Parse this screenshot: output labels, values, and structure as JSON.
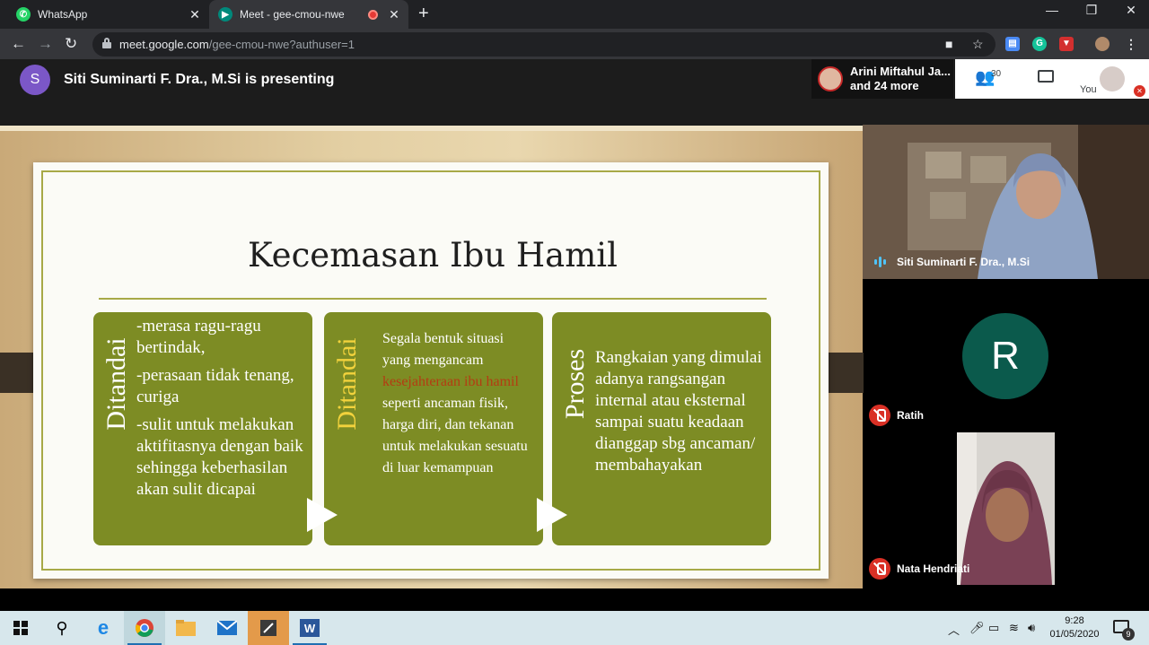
{
  "browser": {
    "tabs": [
      {
        "title": "WhatsApp",
        "icon": "whatsapp-icon",
        "active": false
      },
      {
        "title": "Meet - gee-cmou-nwe",
        "icon": "meet-icon",
        "active": true,
        "recording": true
      }
    ],
    "url_host": "meet.google.com",
    "url_path": "/gee-cmou-nwe?authuser=1"
  },
  "meet": {
    "presenter_initial": "S",
    "presenter_text": "Siti Suminarti F. Dra., M.Si is presenting",
    "attendees_line1": "Arini Miftahul Ja...",
    "attendees_line2": "and 24 more",
    "people_count": "30",
    "you_label": "You"
  },
  "slide": {
    "title": "Kecemasan Ibu Hamil",
    "cards": [
      {
        "vertical_label": "Ditandai",
        "label_color": "#ffffff",
        "lines": [
          "-merasa ragu-ragu bertindak,",
          "-perasaan tidak tenang, curiga",
          "-sulit untuk melakukan aktifitasnya dengan baik sehingga keberhasilan akan sulit dicapai"
        ]
      },
      {
        "vertical_label": "Ditandai",
        "label_color": "#f2d23c",
        "text_before": "Segala bentuk situasi yang mengancam ",
        "text_highlight": "kesejahteraan ibu hamil",
        "text_after": " seperti ancaman fisik, harga diri, dan tekanan untuk melakukan sesuatu di luar kemampuan"
      },
      {
        "vertical_label": "Proses",
        "label_color": "#ffffff",
        "text": "Rangkaian yang dimulai adanya rangsangan internal atau eksternal sampai suatu keadaan dianggap sbg ancaman/ membahayakan"
      }
    ]
  },
  "participants": [
    {
      "name": "Siti Suminarti F. Dra., M.Si",
      "speaking": true,
      "video": true
    },
    {
      "name": "Ratih",
      "initial": "R",
      "muted": true,
      "video": false
    },
    {
      "name": "Nata Hendriati",
      "muted": true,
      "video": true
    }
  ],
  "taskbar": {
    "time": "9:28",
    "date": "01/05/2020",
    "notification_count": "9"
  },
  "colors": {
    "slide_card": "#7d8c24",
    "slide_border": "#a7a947",
    "highlight_text": "#b43c12",
    "presenter_avatar": "#7b57c7",
    "ratih_avatar": "#0b5a4c"
  }
}
